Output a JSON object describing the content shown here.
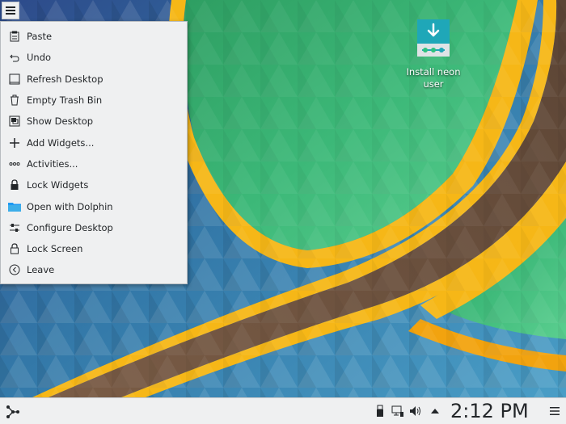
{
  "desktop": {
    "icon": {
      "label": "Install neon user",
      "icon": "download-install-icon"
    }
  },
  "context_menu": {
    "items": [
      {
        "label": "Paste",
        "icon": "paste-icon"
      },
      {
        "label": "Undo",
        "icon": "undo-icon"
      },
      {
        "label": "Refresh Desktop",
        "icon": "refresh-desktop-icon"
      },
      {
        "label": "Empty Trash Bin",
        "icon": "trash-icon"
      },
      {
        "label": "Show Desktop",
        "icon": "show-desktop-icon"
      },
      {
        "label": "Add Widgets...",
        "icon": "add-icon"
      },
      {
        "label": "Activities...",
        "icon": "activities-icon"
      },
      {
        "label": "Lock Widgets",
        "icon": "lock-icon"
      },
      {
        "label": "Open with Dolphin",
        "icon": "folder-icon"
      },
      {
        "label": "Configure Desktop",
        "icon": "configure-icon"
      },
      {
        "label": "Lock Screen",
        "icon": "lock-screen-icon"
      },
      {
        "label": "Leave",
        "icon": "leave-icon"
      }
    ]
  },
  "panel": {
    "clock": "2:12 PM",
    "tray_icons": [
      "usb-device-icon",
      "network-icon",
      "volume-icon",
      "expand-arrow-icon"
    ]
  },
  "colors": {
    "menu_bg": "#eff0f1",
    "text": "#232629",
    "accent": "#1d99f3",
    "wallpaper_green": "#3cb878",
    "wallpaper_gold": "#f6b717",
    "wallpaper_brown": "#6b5140",
    "wallpaper_blue": "#2e6ea0"
  }
}
